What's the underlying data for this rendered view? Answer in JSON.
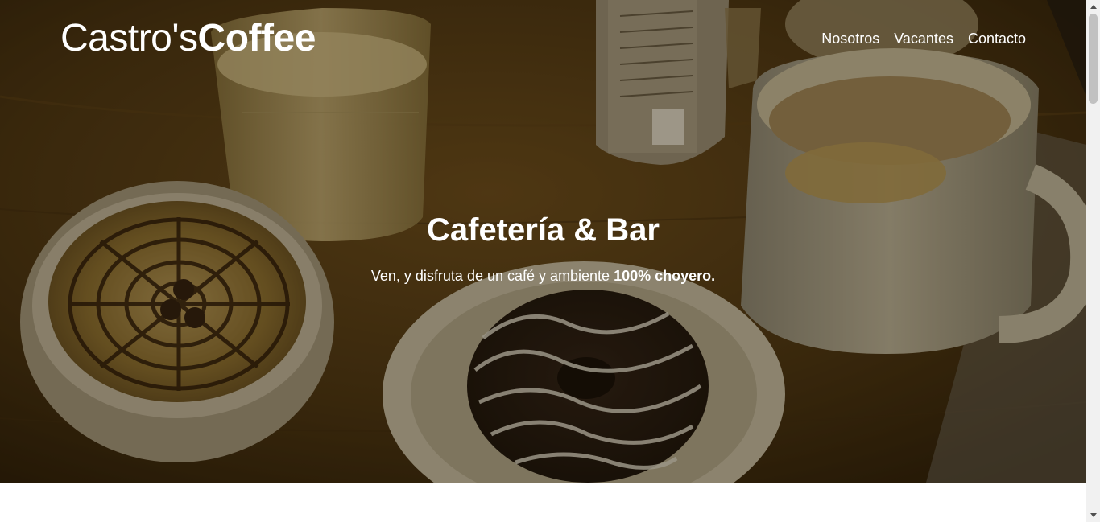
{
  "brand": {
    "light": "Castro's",
    "bold": "Coffee"
  },
  "nav": {
    "items": [
      {
        "label": "Nosotros"
      },
      {
        "label": "Vacantes"
      },
      {
        "label": "Contacto"
      }
    ]
  },
  "hero": {
    "title": "Cafetería & Bar",
    "subtitle_prefix": "Ven, y disfruta de un café y ambiente ",
    "subtitle_bold": "100% choyero."
  },
  "colors": {
    "overlay": "#191004",
    "text": "#ffffff",
    "wood": "#4a3412"
  }
}
